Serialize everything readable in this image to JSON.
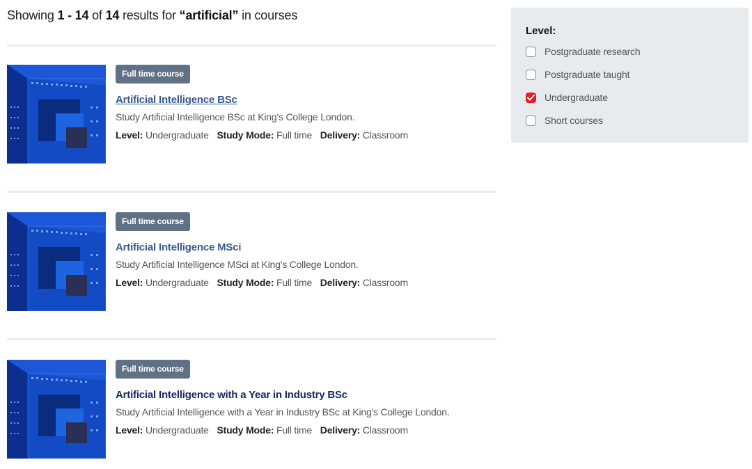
{
  "summary": {
    "prefix": "Showing",
    "range": "1 - 14",
    "of": "of",
    "total": "14",
    "results_for": "results for",
    "query": "“artificial”",
    "suffix": "in courses"
  },
  "results": [
    {
      "badge": "Full time course",
      "title": "Artificial Intelligence BSc",
      "description": "Study Artificial Intelligence BSc at King's College London.",
      "level_label": "Level:",
      "level": "Undergraduate",
      "mode_label": "Study Mode:",
      "mode": "Full time",
      "delivery_label": "Delivery:",
      "delivery": "Classroom",
      "image_icon": "course-thumbnail-image"
    },
    {
      "badge": "Full time course",
      "title": "Artificial Intelligence MSci",
      "description": "Study Artificial Intelligence MSci at King's College London.",
      "level_label": "Level:",
      "level": "Undergraduate",
      "mode_label": "Study Mode:",
      "mode": "Full time",
      "delivery_label": "Delivery:",
      "delivery": "Classroom",
      "image_icon": "course-thumbnail-image"
    },
    {
      "badge": "Full time course",
      "title": "Artificial Intelligence with a Year in Industry BSc",
      "description": "Study Artificial Intelligence with a Year in Industry BSc at King's College London.",
      "level_label": "Level:",
      "level": "Undergraduate",
      "mode_label": "Study Mode:",
      "mode": "Full time",
      "delivery_label": "Delivery:",
      "delivery": "Classroom",
      "image_icon": "course-thumbnail-image"
    }
  ],
  "filter": {
    "title": "Level:",
    "options": [
      {
        "label": "Postgraduate research",
        "checked": false
      },
      {
        "label": "Postgraduate taught",
        "checked": false
      },
      {
        "label": "Undergraduate",
        "checked": true
      },
      {
        "label": "Short courses",
        "checked": false
      }
    ]
  },
  "colors": {
    "badge": "#5f7185",
    "link_visited": "#375a8e",
    "link": "#14295e",
    "checkbox_checked": "#e31e24",
    "filter_bg": "#e8ebee"
  }
}
